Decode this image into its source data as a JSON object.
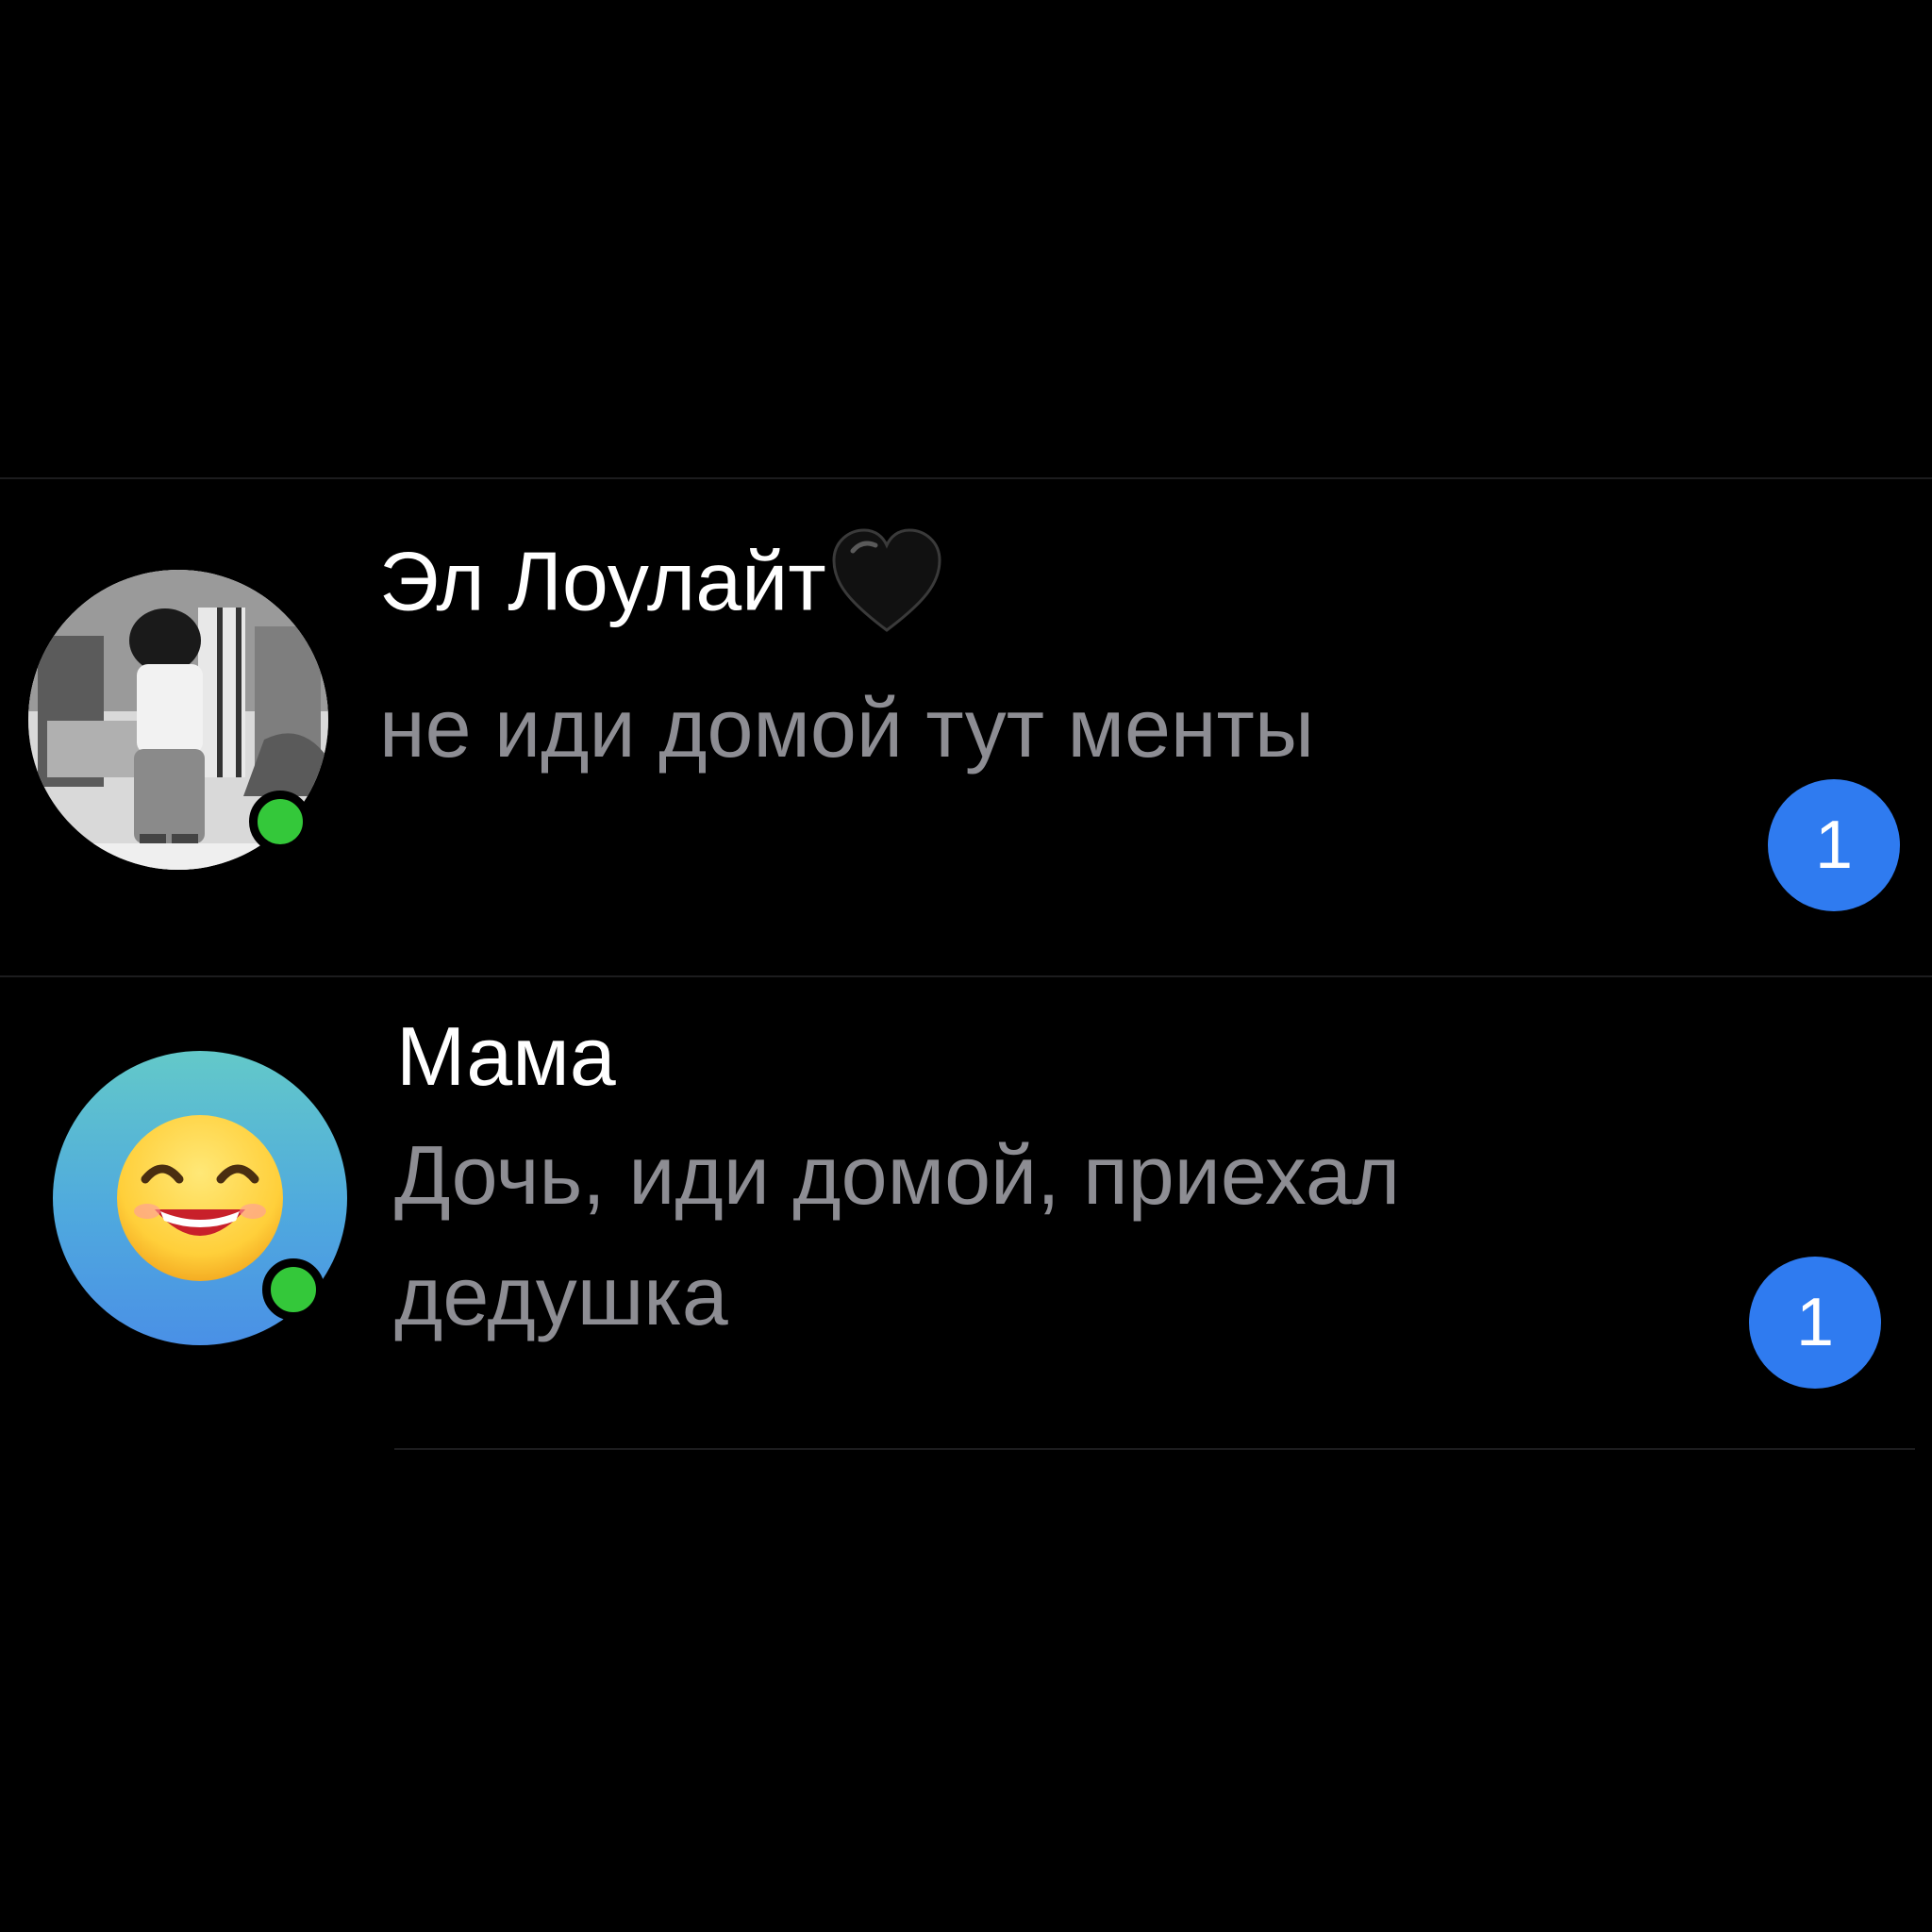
{
  "chats": [
    {
      "name": "Эл Лоулайт",
      "name_emoji": "black-heart-icon",
      "preview": "не иди домой тут менты",
      "unread": "1",
      "online": true,
      "avatar": "manga-character-photo-avatar"
    },
    {
      "name": "Мама",
      "preview": "Дочь, иди домой, приехал дедушка",
      "unread": "1",
      "online": true,
      "avatar": "laughing-emoji-avatar"
    }
  ],
  "colors": {
    "background": "#000000",
    "name_text": "#ffffff",
    "preview_text": "#8d8d93",
    "badge": "#2f7bf0",
    "online": "#34c83a",
    "separator": "#1c1c1e"
  }
}
